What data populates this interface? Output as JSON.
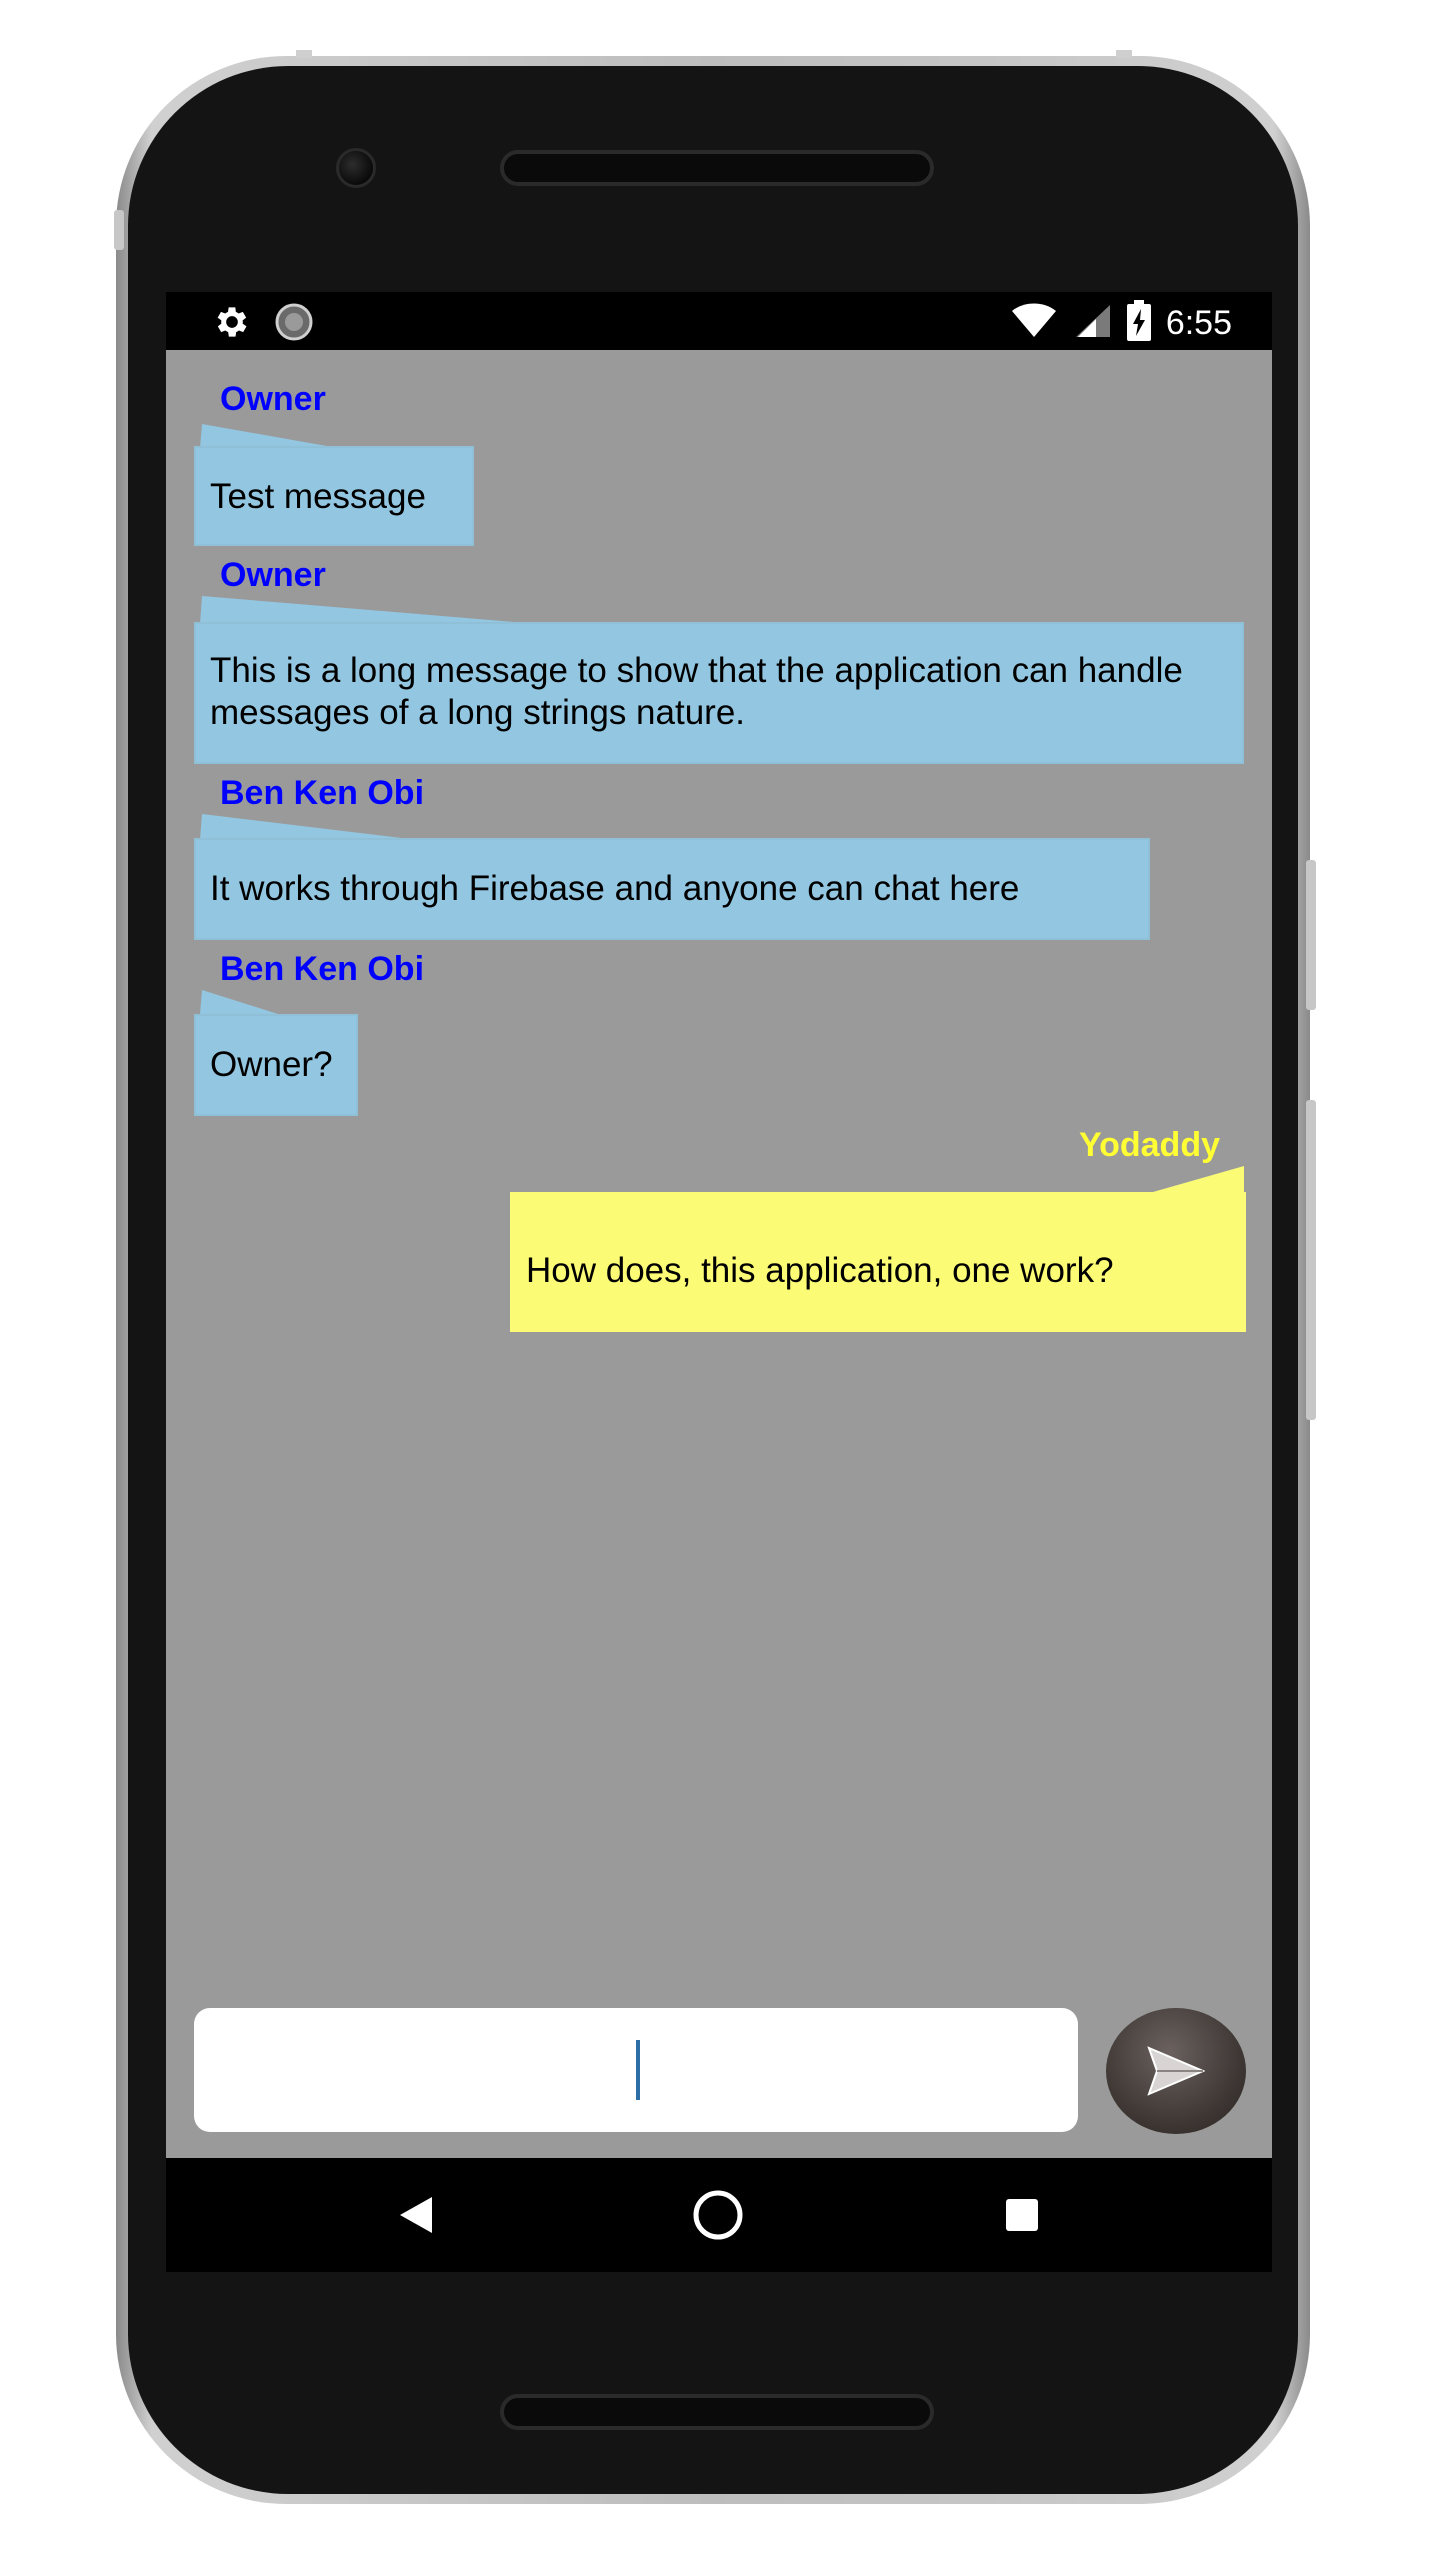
{
  "status_bar": {
    "time": "6:55",
    "left_icons": [
      "gear-icon",
      "circle-icon"
    ],
    "right_icons": [
      "wifi-icon",
      "cell-signal-icon",
      "battery-charging-icon"
    ]
  },
  "messages": [
    {
      "sender": "Owner",
      "text": "Test message",
      "direction": "incoming"
    },
    {
      "sender": "Owner",
      "text": "This is a long message to show that the application can handle messages of a long strings nature.",
      "direction": "incoming"
    },
    {
      "sender": "Ben Ken Obi",
      "text": "It works through Firebase and anyone can chat here",
      "direction": "incoming"
    },
    {
      "sender": "Ben Ken Obi",
      "text": "Owner?",
      "direction": "incoming"
    },
    {
      "sender": "Yodaddy",
      "text": "How does, this application, one work?",
      "direction": "outgoing"
    }
  ],
  "composer": {
    "value": "",
    "send_icon": "send-icon"
  },
  "nav_bar": {
    "buttons": [
      "back-icon",
      "home-icon",
      "recents-icon"
    ]
  },
  "colors": {
    "screen_background": "#9a9a9a",
    "incoming_bubble": "#93c6e0",
    "outgoing_bubble": "#fbfb76",
    "incoming_sender": "#0000ff",
    "outgoing_sender": "#ffff33"
  }
}
